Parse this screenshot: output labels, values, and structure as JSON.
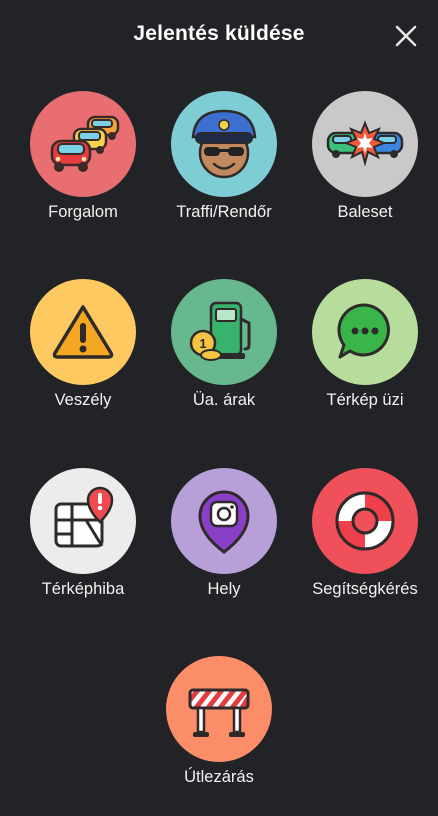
{
  "header": {
    "title": "Jelentés küldése"
  },
  "items": [
    {
      "label": "Forgalom",
      "color": "#e86e71",
      "icon": "traffic-jam-icon"
    },
    {
      "label": "Traffi/Rendőr",
      "color": "#7fcdd4",
      "icon": "police-icon"
    },
    {
      "label": "Baleset",
      "color": "#c9c9c9",
      "icon": "crash-icon"
    },
    {
      "label": "Veszély",
      "color": "#fec961",
      "icon": "hazard-icon"
    },
    {
      "label": "Üa. árak",
      "color": "#68b88f",
      "icon": "fuel-price-icon"
    },
    {
      "label": "Térkép üzi",
      "color": "#b6dd9b",
      "icon": "map-chat-icon"
    },
    {
      "label": "Térképhiba",
      "color": "#ececec",
      "icon": "map-issue-icon"
    },
    {
      "label": "Hely",
      "color": "#b99fd8",
      "icon": "place-icon"
    },
    {
      "label": "Segítségkérés",
      "color": "#f0505a",
      "icon": "lifebuoy-icon"
    },
    {
      "label": "Útlezárás",
      "color": "#fc8d69",
      "icon": "road-closure-icon"
    }
  ]
}
